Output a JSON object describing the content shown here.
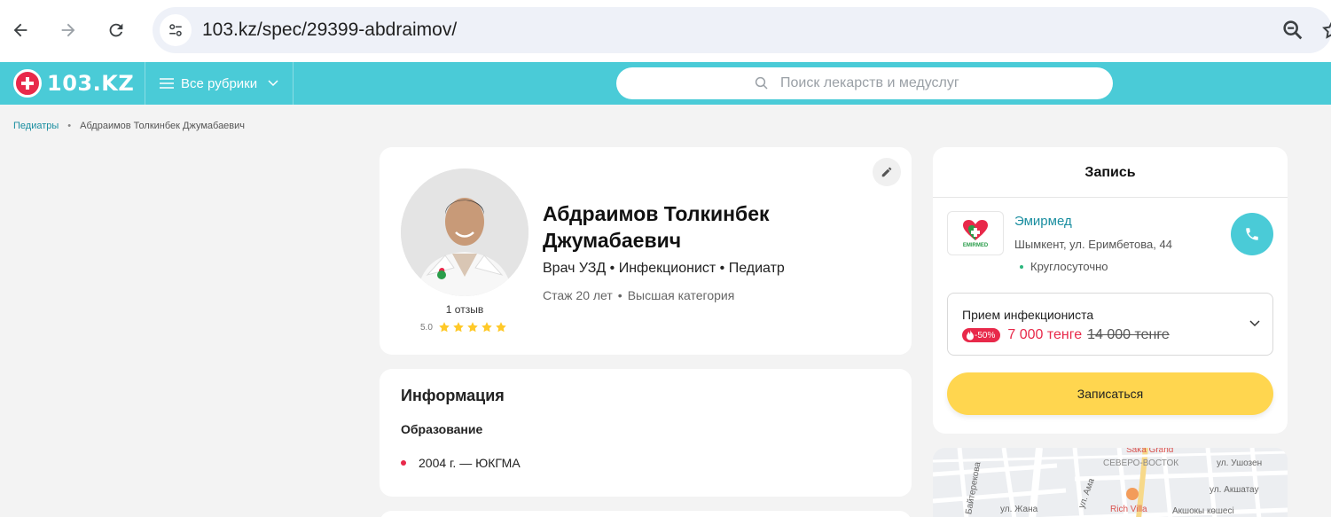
{
  "browser": {
    "url": "103.kz/spec/29399-abdraimov/"
  },
  "site": {
    "logo_text": "103.KZ",
    "rubrics_label": "Все рубрики",
    "search_placeholder": "Поиск лекарств и медуслуг",
    "accent_color": "#4acbd7",
    "brand_red": "#e8294a"
  },
  "breadcrumb": {
    "items": [
      "Педиатры",
      "Абдраимов Толкинбек Джумабаевич"
    ]
  },
  "profile": {
    "name": "Абдраимов Толкинбек Джумабаевич",
    "specialties": "Врач УЗД • Инфекционист • Педиатр",
    "experience": "Стаж 20 лет",
    "category": "Высшая категория",
    "reviews_count": "1 отзыв",
    "rating": "5.0",
    "stars": 5
  },
  "info": {
    "title": "Информация",
    "education_title": "Образование",
    "education_items": [
      "2004 г. — ЮКГМА"
    ]
  },
  "booking": {
    "title": "Запись",
    "clinic_name": "Эмирмед",
    "clinic_logo_text": "EMIRMED",
    "clinic_address": "Шымкент, ул. Еримбетова, 44",
    "clinic_hours": "Круглосуточно",
    "service_name": "Прием инфекциониста",
    "discount": "-50%",
    "price_new": "7 000 тенге",
    "price_old": "14 000 тенге",
    "book_button": "Записаться"
  },
  "map": {
    "labels": [
      "Saka Grand",
      "СЕВЕРО-ВОСТОК",
      "ул. Ушозен",
      "ул. Акшатау",
      "Rich Villa",
      "Акшокы көшесі",
      "ул. Жана",
      "Байтерекова",
      "ул. Ама"
    ]
  }
}
